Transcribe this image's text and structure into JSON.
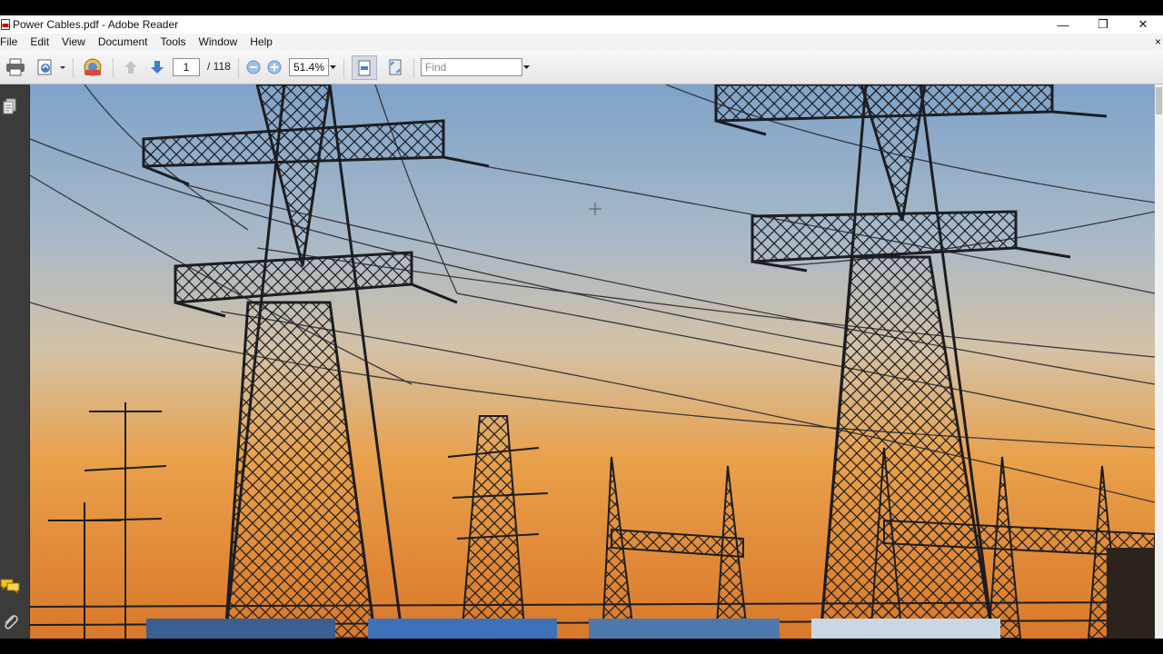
{
  "window": {
    "title": "Power Cables.pdf - Adobe Reader",
    "minimize_glyph": "—",
    "restore_glyph": "❐",
    "close_glyph": "✕"
  },
  "menu": {
    "items": [
      "File",
      "Edit",
      "View",
      "Document",
      "Tools",
      "Window",
      "Help"
    ],
    "close_glyph": "×"
  },
  "toolbar": {
    "page_current": "1",
    "page_total": "/ 118",
    "zoom": "51.4%",
    "find_placeholder": "Find"
  },
  "icons": {
    "print": "print-icon",
    "export": "export-pdf-icon",
    "share": "share-icon",
    "prev_page": "arrow-up-icon",
    "next_page": "arrow-down-icon",
    "zoom_out": "zoom-out-icon",
    "zoom_in": "zoom-in-icon",
    "fit_width": "fit-width-icon",
    "fit_page": "fit-page-icon",
    "pages_panel": "pages-panel-icon",
    "comments": "comments-icon",
    "attachments": "paperclip-icon"
  },
  "colors": {
    "sky_top": "#7fa3c9",
    "sky_mid": "#c9c0b3",
    "sunset": "#e9a04a",
    "horizon": "#d9782a",
    "tower": "#1c1d22"
  }
}
